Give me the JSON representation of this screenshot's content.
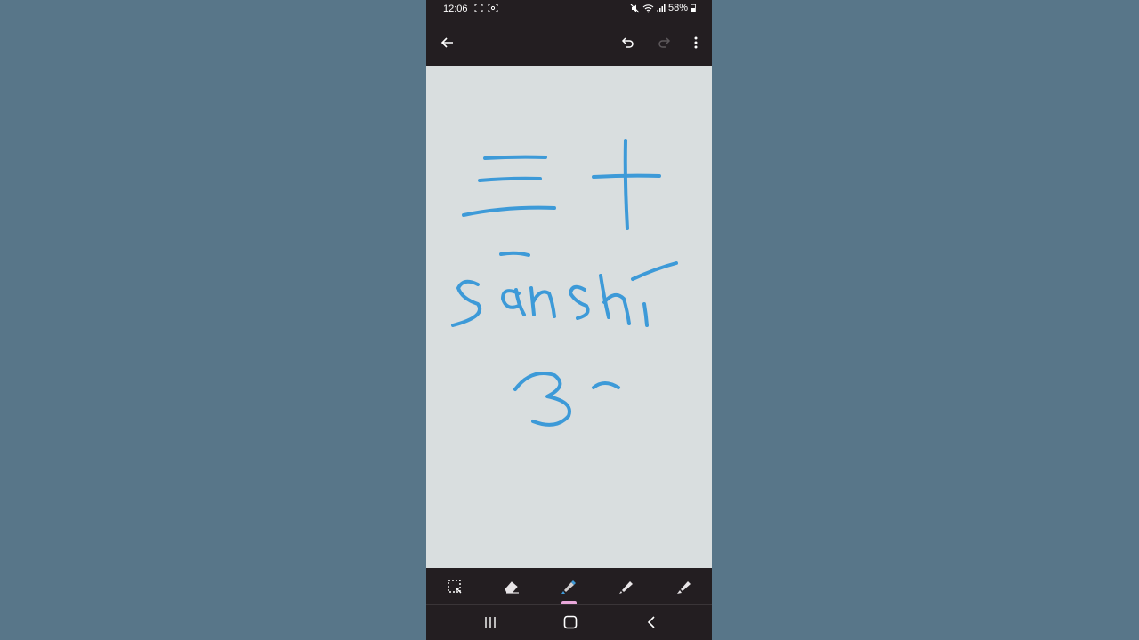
{
  "status_bar": {
    "time": "12:06",
    "battery": "58%",
    "left_icons": [
      "screenshot-icon",
      "screen-record-icon"
    ],
    "right_icons": [
      "mute-icon",
      "wifi-icon",
      "signal-icon",
      "battery-icon"
    ]
  },
  "app_bar": {
    "icons": [
      "back-arrow-icon",
      "undo-icon",
      "redo-icon",
      "more-vert-icon"
    ]
  },
  "canvas": {
    "background": "#d9dedf",
    "ink_color": "#3d9ad8",
    "content": [
      "三十",
      "sanshi",
      "3-"
    ]
  },
  "toolbar": {
    "tools": [
      "lasso-select-icon",
      "eraser-icon",
      "highlighter-icon",
      "pen-icon",
      "marker-icon"
    ],
    "active_tool": "highlighter-icon",
    "indicator_color": "#e8a7da"
  },
  "nav_bar": {
    "icons": [
      "recent-apps-icon",
      "home-icon",
      "nav-back-icon"
    ]
  },
  "colors": {
    "background": "#587689",
    "chrome": "#231e21"
  }
}
